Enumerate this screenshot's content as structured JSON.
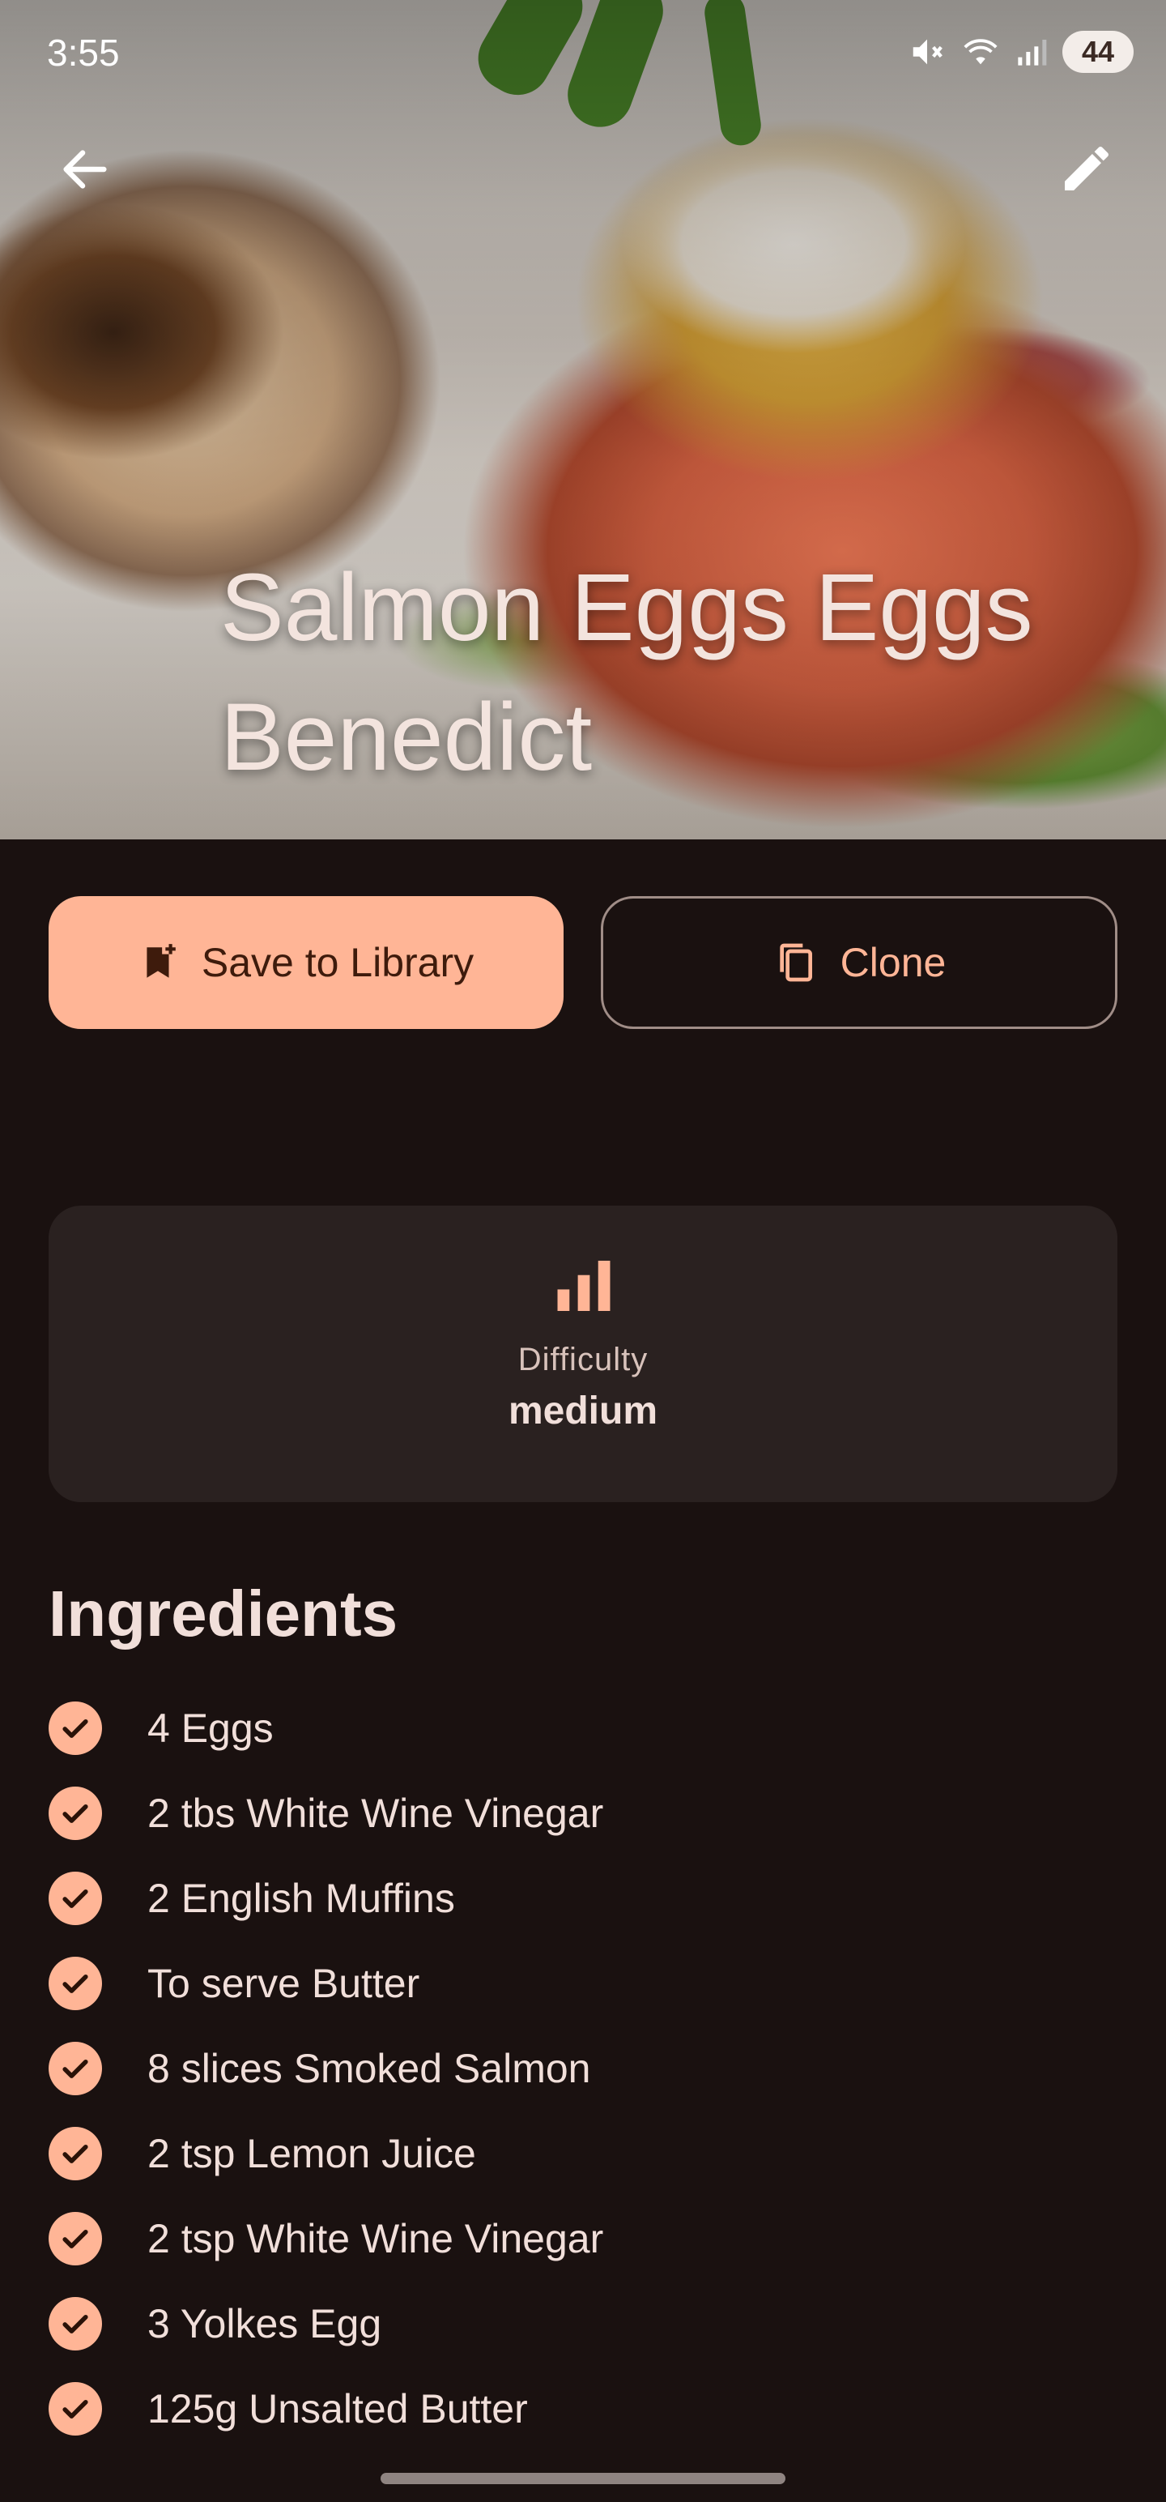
{
  "status_bar": {
    "time": "3:55",
    "battery": "44",
    "icons": [
      "mute-icon",
      "wifi-icon",
      "signal-icon"
    ]
  },
  "top_bar": {
    "back_icon": "arrow-left-icon",
    "edit_icon": "pencil-icon"
  },
  "recipe": {
    "title": "Salmon Eggs Eggs Benedict"
  },
  "actions": {
    "save_label": "Save to Library",
    "save_icon": "bookmark-add-icon",
    "clone_label": "Clone",
    "clone_icon": "copy-icon"
  },
  "difficulty": {
    "label": "Difficulty",
    "value": "medium",
    "icon": "bar-chart-icon"
  },
  "ingredients": {
    "heading": "Ingredients",
    "items": [
      "4 Eggs",
      "2 tbs White Wine Vinegar",
      "2 English Muffins",
      "To serve Butter",
      "8 slices Smoked Salmon",
      "2 tsp Lemon Juice",
      "2 tsp White Wine Vinegar",
      "3 Yolkes Egg",
      "125g Unsalted Butter"
    ]
  },
  "colors": {
    "background": "#1a1110",
    "accent": "#ffb596",
    "card": "#2a2120",
    "text": "#f1dfda"
  }
}
